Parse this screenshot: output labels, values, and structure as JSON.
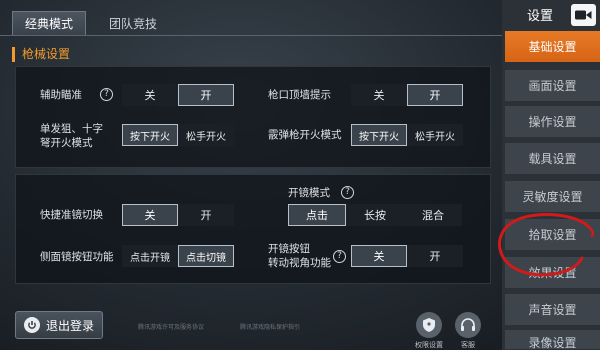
{
  "tabs": [
    {
      "label": "经典模式",
      "active": true
    },
    {
      "label": "团队竞技",
      "active": false
    }
  ],
  "section_title": "枪械设置",
  "panel1": {
    "rows": [
      {
        "label": "辅助瞄准",
        "options": [
          "关",
          "开"
        ],
        "selected": 1
      },
      {
        "label": "枪口顶墙提示",
        "options": [
          "关",
          "开"
        ],
        "selected": 1
      },
      {
        "label_lines": [
          "单发狙、十字",
          "弩开火模式"
        ],
        "options": [
          "按下开火",
          "松手开火"
        ],
        "selected": 0
      },
      {
        "label": "霰弹枪开火模式",
        "options": [
          "按下开火",
          "松手开火"
        ],
        "selected": 0
      }
    ]
  },
  "panel2": {
    "scope_mode_label": "开镜模式",
    "scope_mode_options": [
      "点击",
      "长按",
      "混合"
    ],
    "scope_mode_selected": 0,
    "quick_scope": {
      "label": "快捷准镜切换",
      "options": [
        "关",
        "开"
      ],
      "selected": 0
    },
    "side_button": {
      "label": "侧面镜按钮功能",
      "options": [
        "点击开镜",
        "点击切镜"
      ],
      "selected": 1
    },
    "rotate_view": {
      "label_lines": [
        "开镜按钮",
        "转动视角功能"
      ],
      "options": [
        "关",
        "开"
      ],
      "selected": 0
    }
  },
  "help_glyph": "?",
  "bottom": {
    "logout_label": "退出登录",
    "link1": "腾讯游戏许可及服务协议",
    "link2": "腾讯游戏隐私保护指引",
    "permission_label": "权限设置",
    "service_label": "客服"
  },
  "sidebar": {
    "title": "设置",
    "items": [
      {
        "label": "基础设置",
        "active": true
      },
      {
        "label": "画面设置",
        "active": false
      },
      {
        "label": "操作设置",
        "active": false
      },
      {
        "label": "载具设置",
        "active": false
      },
      {
        "label": "灵敏度设置",
        "active": false
      },
      {
        "label": "拾取设置",
        "active": false
      },
      {
        "label": "效果设置",
        "active": false
      },
      {
        "label": "声音设置",
        "active": false
      },
      {
        "label": "录像设置",
        "active": false
      }
    ]
  },
  "colors": {
    "accent_orange": "#e77a26",
    "section_orange": "#f29a2e",
    "annotation_red": "#d11a1a",
    "sidebar_item_bg": "#3e444b"
  },
  "icons": [
    "video-camera-icon",
    "help-icon",
    "logout-icon",
    "shield-icon",
    "headset-icon"
  ]
}
